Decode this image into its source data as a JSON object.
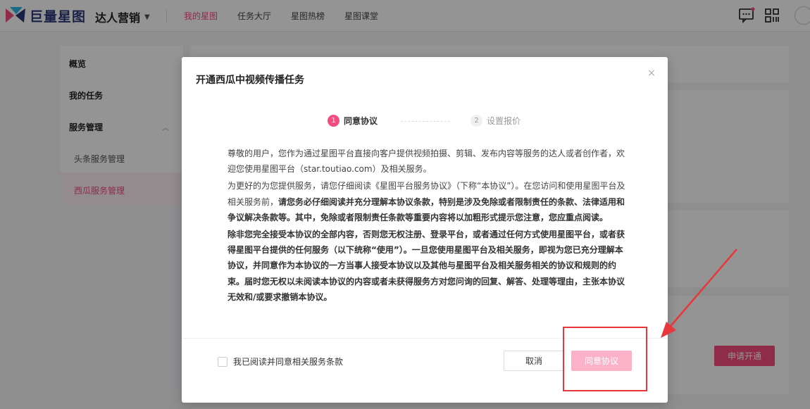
{
  "topbar": {
    "logo_text": "巨量星图",
    "brand_switch": "达人营销",
    "nav": [
      {
        "label": "我的星图",
        "active": true
      },
      {
        "label": "任务大厅",
        "active": false
      },
      {
        "label": "星图热榜",
        "active": false
      },
      {
        "label": "星图课堂",
        "active": false
      }
    ]
  },
  "sidebar": {
    "overview": "概览",
    "my_tasks": "我的任务",
    "service_mgmt": "服务管理",
    "toutiao_mgmt": "头条服务管理",
    "xigua_mgmt": "西瓜服务管理"
  },
  "background": {
    "apply_label": "申请开通"
  },
  "modal": {
    "title": "开通西瓜中视频传播任务",
    "close": "×",
    "steps": [
      {
        "num": "1",
        "label": "同意协议"
      },
      {
        "num": "2",
        "label": "设置报价"
      }
    ],
    "para1": "尊敬的用户，您作为通过星图平台直接向客户提供视频拍摄、剪辑、发布内容等服务的达人或者创作者，欢迎您使用星图平台（star.toutiao.com）及相关服务。",
    "para2_normal": "为更好的为您提供服务，请您仔细阅读《星图平台服务协议》（下称“本协议”）。在您访问和使用星图平台及相关服务前，",
    "para2_bold": "请您务必仔细阅读并充分理解本协议条款，特别是涉及免除或者限制责任的条款、法律适用和争议解决条款等。其中，免除或者限制责任条款等重要内容将以加粗形式提示您注意，您应重点阅读。",
    "para3_bold": "除非您完全接受本协议的全部内容，否则您无权注册、登录平台，或者通过任何方式使用星图平台，或者获得星图平台提供的任何服务（以下统称“使用”）。一旦您使用星图平台及相关服务，即视为您已充分理解本协议，并同意作为本协议的一方当事人接受本协议以及其他与星图平台及相关服务相关的协议和规则的约束。届时您无权以未阅读本协议的内容或者未获得服务方对您问询的回复、解答、处理等理由，主张本协议无效和/或要求撤销本协议。",
    "checkbox_label": "我已阅读并同意相关服务条款",
    "cancel_label": "取消",
    "agree_label": "同意协议"
  },
  "colors": {
    "accent": "#f44c7f",
    "accent_disabled": "#fbb2c8",
    "annotation": "#e8373a"
  }
}
